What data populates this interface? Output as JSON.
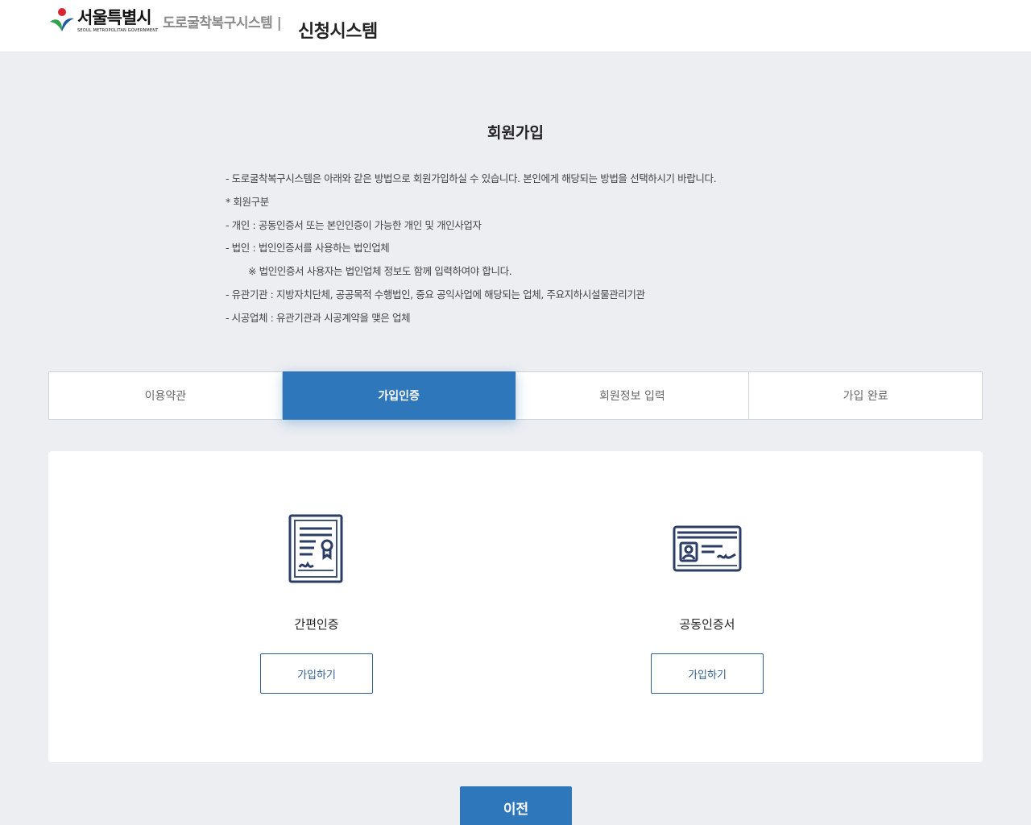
{
  "header": {
    "logo_kr": "서울특별시",
    "logo_en": "SEOUL METROPOLITAN GOVERNMENT",
    "system_name": "도로굴착복구시스템 |",
    "system_sub": "신청시스템"
  },
  "page": {
    "title": "회원가입"
  },
  "notice": [
    "- 도로굴착복구시스템은 아래와 같은 방법으로 회원가입하실 수 있습니다. 본인에게 해당되는 방법을 선택하시기 바랍니다.",
    "* 회원구분",
    "- 개인 : 공동인증서 또는 본인인증이 가능한 개인 및 개인사업자",
    "- 법인 : 법인인증서를 사용하는 법인업체",
    "※ 법인인증서 사용자는 법인업체 정보도 함께 입력하여야 합니다.",
    "- 유관기관 : 지방자치단체, 공공목적 수행법인, 중요 공익사업에 해당되는 업체, 주요지하시설물관리기관",
    "- 시공업체 : 유관기관과 시공계약을 맺은 업체"
  ],
  "steps": [
    {
      "label": "이용약관",
      "active": false
    },
    {
      "label": "가입인증",
      "active": true
    },
    {
      "label": "회원정보 입력",
      "active": false
    },
    {
      "label": "가입 완료",
      "active": false
    }
  ],
  "options": {
    "simple": {
      "label": "간편인증",
      "button": "가입하기",
      "icon": "certificate-document-icon"
    },
    "joint": {
      "label": "공동인증서",
      "button": "가입하기",
      "icon": "id-card-icon"
    }
  },
  "footer": {
    "prev_button": "이전"
  },
  "colors": {
    "primary": "#2f77bb",
    "icon_navy": "#2c3e66",
    "button_border": "#2f5e92",
    "background": "#eceef2"
  }
}
